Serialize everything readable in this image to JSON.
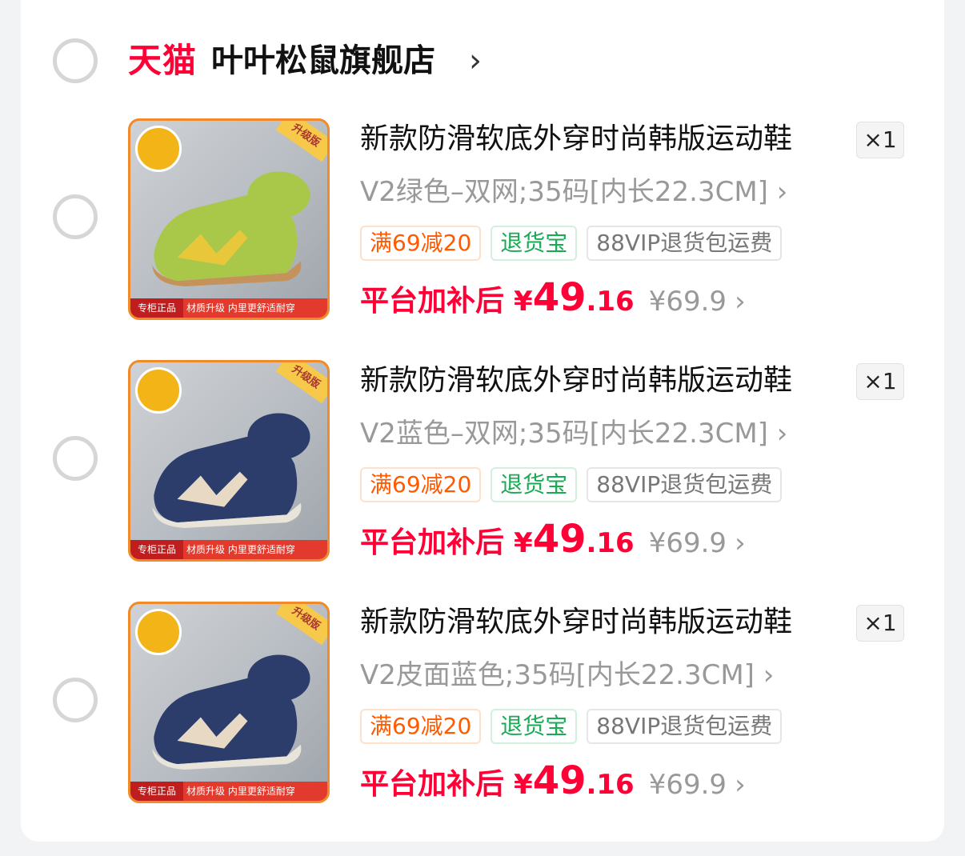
{
  "store": {
    "brand": "天猫",
    "name": "叶叶松鼠旗舰店",
    "chevron": "›"
  },
  "colors": {
    "brand_red": "#ff0036",
    "tag_orange": "#ff5a00",
    "tag_green": "#1aaa55",
    "muted_gray": "#999999"
  },
  "items": [
    {
      "title": "新款防滑软底外穿时尚韩版运动鞋",
      "spec": "V2绿色–双网;35码[内长22.3CM] ›",
      "quantity": "×1",
      "tags": [
        "满69减20",
        "退货宝",
        "88VIP退货包运费"
      ],
      "price_label": "平台加补后",
      "price_symbol": "¥",
      "price_int": "49",
      "price_dec": ".16",
      "original_price": "¥69.9",
      "original_chevron": "›",
      "shoe_color": "#a9c84a",
      "shoe_accent": "#e8c83a",
      "image_text": {
        "corner_badge": "升级版",
        "bar_left": "专柜正品",
        "bar_right": "材质升级 内里更舒适耐穿"
      }
    },
    {
      "title": "新款防滑软底外穿时尚韩版运动鞋",
      "spec": "V2蓝色–双网;35码[内长22.3CM] ›",
      "quantity": "×1",
      "tags": [
        "满69减20",
        "退货宝",
        "88VIP退货包运费"
      ],
      "price_label": "平台加补后",
      "price_symbol": "¥",
      "price_int": "49",
      "price_dec": ".16",
      "original_price": "¥69.9",
      "original_chevron": "›",
      "shoe_color": "#2c3d6b",
      "shoe_accent": "#e8d9c4",
      "image_text": {
        "corner_badge": "升级版",
        "bar_left": "专柜正品",
        "bar_right": "材质升级 内里更舒适耐穿"
      }
    },
    {
      "title": "新款防滑软底外穿时尚韩版运动鞋",
      "spec": "V2皮面蓝色;35码[内长22.3CM] ›",
      "quantity": "×1",
      "tags": [
        "满69减20",
        "退货宝",
        "88VIP退货包运费"
      ],
      "price_label": "平台加补后",
      "price_symbol": "¥",
      "price_int": "49",
      "price_dec": ".16",
      "original_price": "¥69.9",
      "original_chevron": "›",
      "shoe_color": "#2c3d6b",
      "shoe_accent": "#e8d9c4",
      "image_text": {
        "corner_badge": "升级版",
        "bar_left": "专柜正品",
        "bar_right": "材质升级 内里更舒适耐穿"
      }
    }
  ]
}
